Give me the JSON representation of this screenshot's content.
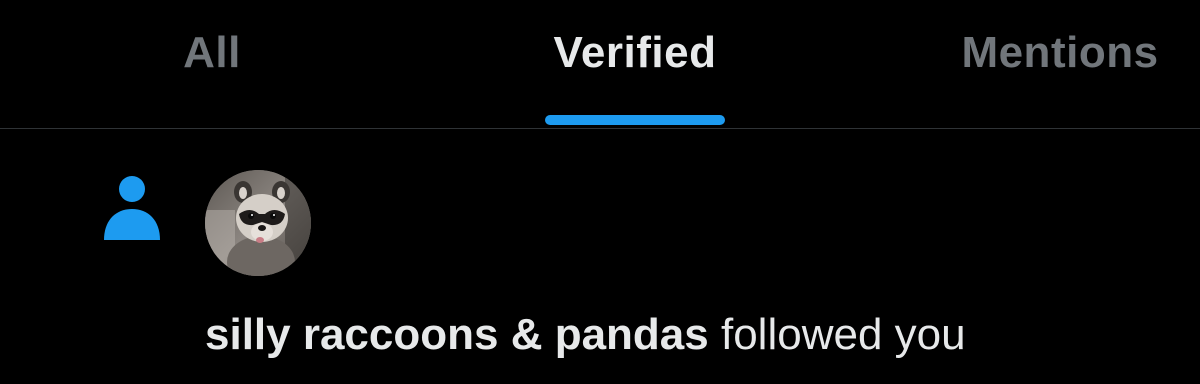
{
  "tabs": [
    {
      "label": "All",
      "active": false
    },
    {
      "label": "Verified",
      "active": true
    },
    {
      "label": "Mentions",
      "active": false
    }
  ],
  "colors": {
    "background": "#000000",
    "accent": "#1d9bf0",
    "text_primary": "#e7e9ea",
    "text_secondary": "#71767b",
    "divider": "#2f3336"
  },
  "notification": {
    "type_icon": "person-follow-icon",
    "avatar_icon": "raccoon-avatar",
    "user_name": "silly raccoons & pandas",
    "action_text": "followed you"
  }
}
